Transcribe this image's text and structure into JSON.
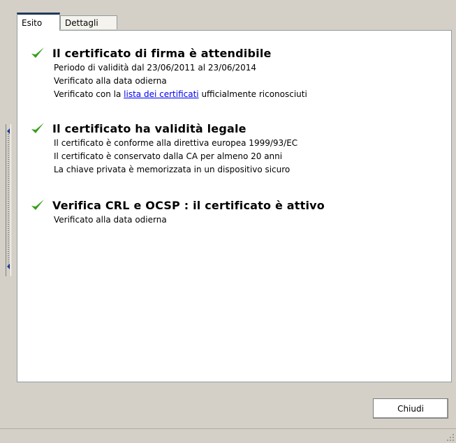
{
  "tabs": [
    {
      "label": "Esito",
      "active": true
    },
    {
      "label": "Dettagli",
      "active": false
    }
  ],
  "sections": [
    {
      "title": "Il certificato di firma è attendibile",
      "lines": [
        "Periodo di validità dal 23/06/2011 al 23/06/2014",
        "Verificato alla data odierna"
      ],
      "link_line": {
        "prefix": "Verificato con la ",
        "link": "lista dei certificati",
        "suffix": " ufficialmente riconosciuti"
      }
    },
    {
      "title": "Il certificato ha validità legale",
      "lines": [
        "Il certificato è conforme alla direttiva europea 1999/93/EC",
        "Il certificato è conservato dalla CA per almeno 20 anni",
        "La chiave privata è memorizzata in un dispositivo sicuro"
      ]
    },
    {
      "title": "Verifica CRL e OCSP : il certificato è attivo",
      "lines": [
        "Verificato alla data odierna"
      ]
    }
  ],
  "buttons": {
    "close": "Chiudi"
  },
  "colors": {
    "check": "#3a9e1f",
    "link": "#0000ee",
    "active_tab_accent": "#1e395b"
  },
  "icons": {
    "status": "check-icon",
    "resize": "resize-grip-icon",
    "splitter_arrow": "arrow-left-icon"
  }
}
